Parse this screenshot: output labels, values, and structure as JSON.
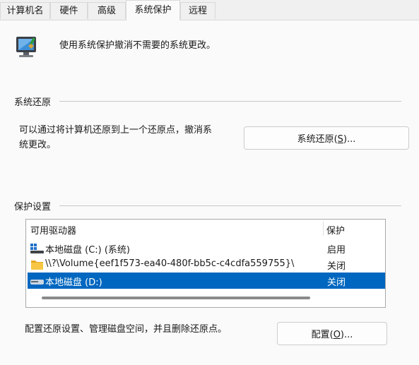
{
  "tabs": [
    {
      "label": "计算机名"
    },
    {
      "label": "硬件"
    },
    {
      "label": "高级"
    },
    {
      "label": "系统保护"
    },
    {
      "label": "远程"
    }
  ],
  "intro": {
    "text": "使用系统保护撤消不需要的系统更改。"
  },
  "restore_section": {
    "title": "系统还原",
    "desc_line1": "可以通过将计算机还原到上一个还原点，撤消系",
    "desc_line2": "统更改。",
    "button_label_pre": "系统还原(",
    "button_key": "S",
    "button_label_post": ")..."
  },
  "protection_section": {
    "title": "保护设置",
    "columns": [
      "可用驱动器",
      "保护"
    ],
    "drives": [
      {
        "name": "本地磁盘 (C:) (系统)",
        "status": "启用",
        "icon": "system-drive-icon"
      },
      {
        "name": "\\\\?\\Volume{eef1f573-ea40-480f-bb5c-c4cdfa559755}\\",
        "status": "关闭",
        "icon": "folder-icon"
      },
      {
        "name": "本地磁盘 (D:)",
        "status": "关闭",
        "icon": "drive-icon"
      }
    ],
    "config_desc": "配置还原设置、管理磁盘空间，并且删除还原点。",
    "config_label_pre": "配置(",
    "config_key": "O",
    "config_label_post": ")..."
  },
  "colors": {
    "selection": "#0067c0",
    "panel": "#fafafa"
  }
}
